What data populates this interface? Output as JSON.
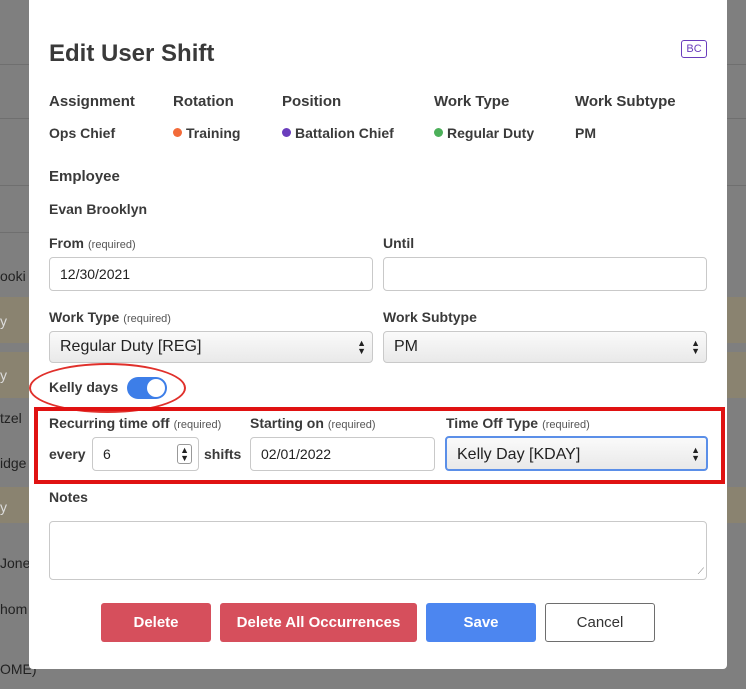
{
  "background": {
    "rows": [
      "ooki",
      "y",
      "y",
      "tzel",
      "idge",
      "y",
      "Jone",
      "hom",
      "OME)"
    ]
  },
  "modal": {
    "title": "Edit User Shift",
    "badge": "BC",
    "info": {
      "assignment": {
        "label": "Assignment",
        "value": "Ops Chief"
      },
      "rotation": {
        "label": "Rotation",
        "value": "Training",
        "color": "#f26b3a"
      },
      "position": {
        "label": "Position",
        "value": "Battalion Chief",
        "color": "#6a3dbd"
      },
      "work_type": {
        "label": "Work Type",
        "value": "Regular Duty",
        "color": "#4cb05a"
      },
      "work_subtype": {
        "label": "Work Subtype",
        "value": "PM"
      }
    },
    "employee": {
      "label": "Employee",
      "value": "Evan Brooklyn"
    },
    "from": {
      "label": "From",
      "required": "(required)",
      "value": "12/30/2021"
    },
    "until": {
      "label": "Until",
      "value": ""
    },
    "work_type_select": {
      "label": "Work Type",
      "required": "(required)",
      "value": "Regular Duty [REG]"
    },
    "work_subtype_select": {
      "label": "Work Subtype",
      "value": "PM"
    },
    "kelly_days": {
      "label": "Kelly days",
      "enabled": true
    },
    "recurring": {
      "label": "Recurring time off",
      "required": "(required)",
      "every": "every",
      "value": "6",
      "unit": "shifts"
    },
    "starting_on": {
      "label": "Starting on",
      "required": "(required)",
      "value": "02/01/2022"
    },
    "time_off_type": {
      "label": "Time Off Type",
      "required": "(required)",
      "value": "Kelly Day [KDAY]"
    },
    "notes": {
      "label": "Notes",
      "value": ""
    },
    "buttons": {
      "delete": "Delete",
      "delete_all": "Delete All Occurrences",
      "save": "Save",
      "cancel": "Cancel"
    }
  }
}
